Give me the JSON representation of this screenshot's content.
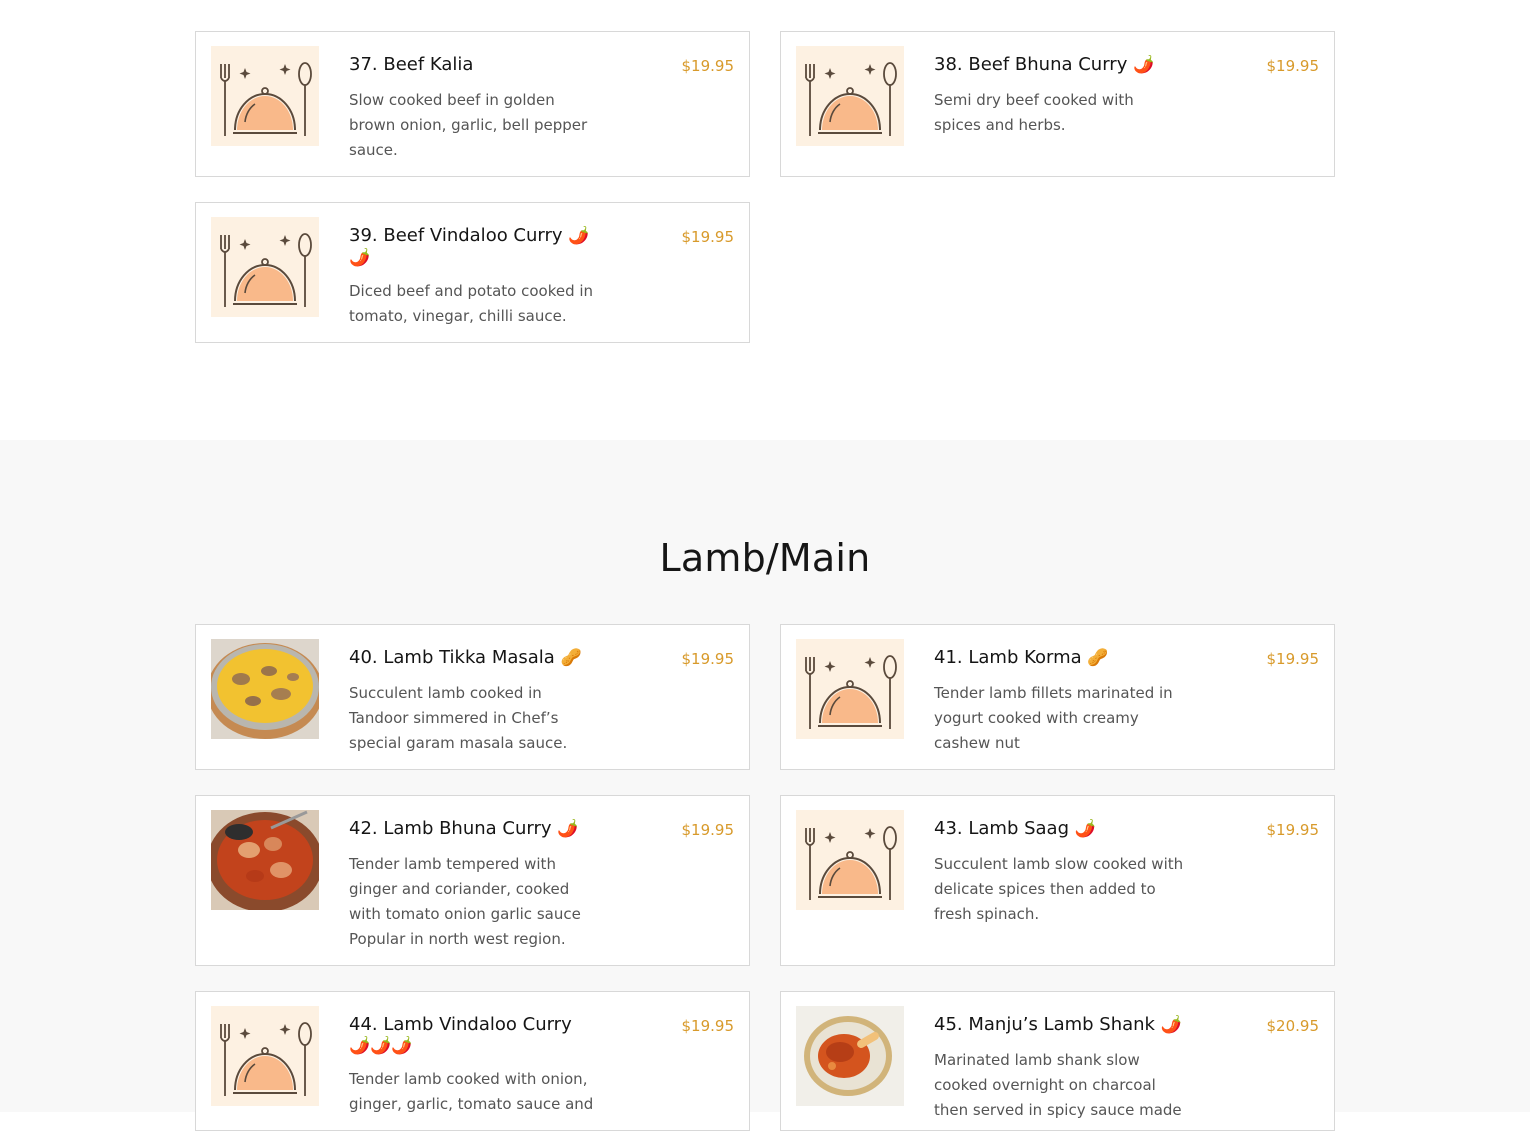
{
  "beef_items": [
    {
      "name": "37. Beef Kalia",
      "price": "$19.95",
      "desc": "Slow cooked beef in golden brown onion, garlic, bell pepper sauce.",
      "image": "placeholder",
      "badges": ""
    },
    {
      "name": "38. Beef Bhuna Curry",
      "price": "$19.95",
      "desc": "Semi dry beef cooked with spices and herbs.",
      "image": "placeholder",
      "badges": "🌶️"
    },
    {
      "name": "39. Beef Vindaloo Curry",
      "price": "$19.95",
      "desc": "Diced beef and potato cooked in tomato, vinegar, chilli sauce.",
      "image": "placeholder",
      "badges": "🌶️ 🌶️"
    }
  ],
  "lamb_section": {
    "title": "Lamb/Main"
  },
  "lamb_items": [
    {
      "name": "40. Lamb Tikka Masala",
      "price": "$19.95",
      "desc": "Succulent lamb cooked in Tandoor simmered in Chef’s special garam masala sauce.",
      "image": "curry-bowl-yellow",
      "badges": "🥜"
    },
    {
      "name": "41. Lamb Korma",
      "price": "$19.95",
      "desc": "Tender lamb fillets marinated in yogurt cooked with creamy cashew nut",
      "image": "placeholder",
      "badges": "🥜"
    },
    {
      "name": "42. Lamb Bhuna Curry",
      "price": "$19.95",
      "desc": "Tender lamb tempered with ginger and coriander, cooked with tomato onion garlic sauce Popular in north west region.",
      "image": "curry-bowl-red",
      "badges": "🌶️"
    },
    {
      "name": "43. Lamb Saag",
      "price": "$19.95",
      "desc": "Succulent lamb slow cooked with delicate spices then added to fresh spinach.",
      "image": "placeholder",
      "badges": "🌶️"
    },
    {
      "name": "44. Lamb Vindaloo Curry",
      "price": "$19.95",
      "desc": "Tender lamb cooked with onion, ginger, garlic, tomato sauce and",
      "image": "placeholder",
      "badges": "🌶️🌶️🌶️"
    },
    {
      "name": "45. Manju’s Lamb Shank",
      "price": "$20.95",
      "desc": "Marinated lamb shank slow cooked overnight on charcoal then served in spicy sauce made",
      "image": "lamb-shank-plate",
      "badges": "🌶️"
    }
  ],
  "colors": {
    "price": "#d89a2b",
    "placeholder_bg": "#fdf1e2",
    "placeholder_dome": "#f9b98a",
    "placeholder_line": "#5a4a3c",
    "section_grey": "#f8f8f8"
  }
}
